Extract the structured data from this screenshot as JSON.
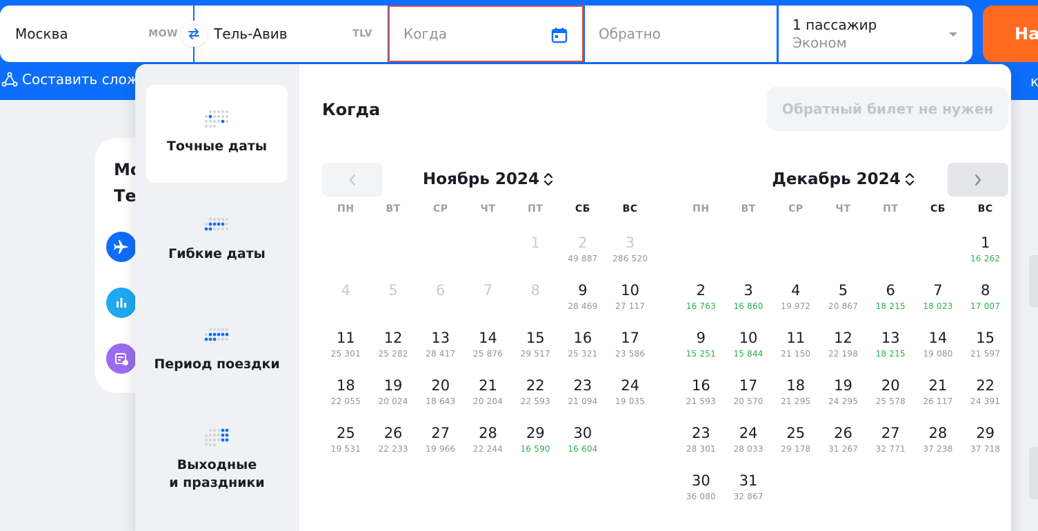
{
  "search": {
    "origin_city": "Москва",
    "origin_code": "MOW",
    "dest_city": "Тель-Авив",
    "dest_code": "TLV",
    "date_placeholder": "Когда",
    "return_placeholder": "Обратно",
    "passengers": "1 пассажир",
    "cabin": "Эконом",
    "button_label": "На"
  },
  "subbar": {
    "compose_link": "Составить слож",
    "right_fragment": "к"
  },
  "background": {
    "card_line1": "Мо",
    "card_line2": "Те"
  },
  "popup": {
    "title": "Когда",
    "no_return": "Обратный билет не нужен",
    "modes": [
      {
        "label": "Точные даты",
        "active": true
      },
      {
        "label": "Гибкие даты",
        "active": false
      },
      {
        "label": "Период поездки",
        "active": false
      },
      {
        "label": "Выходные\nи праздники",
        "active": false
      }
    ]
  },
  "weekdays": [
    "ПН",
    "ВТ",
    "СР",
    "ЧТ",
    "ПТ",
    "СБ",
    "ВС"
  ],
  "months": [
    {
      "title": "Ноябрь 2024",
      "offset": 4,
      "days": [
        {
          "d": "1",
          "price": "",
          "past": true
        },
        {
          "d": "2",
          "price": "49 887",
          "past": true
        },
        {
          "d": "3",
          "price": "286 520",
          "past": true
        },
        {
          "d": "4",
          "price": "",
          "past": true
        },
        {
          "d": "5",
          "price": "",
          "past": true
        },
        {
          "d": "6",
          "price": "",
          "past": true
        },
        {
          "d": "7",
          "price": "",
          "past": true
        },
        {
          "d": "8",
          "price": "",
          "past": true
        },
        {
          "d": "9",
          "price": "28 469"
        },
        {
          "d": "10",
          "price": "27 117"
        },
        {
          "d": "11",
          "price": "25 301"
        },
        {
          "d": "12",
          "price": "25 282"
        },
        {
          "d": "13",
          "price": "28 417"
        },
        {
          "d": "14",
          "price": "25 876"
        },
        {
          "d": "15",
          "price": "29 517"
        },
        {
          "d": "16",
          "price": "25 321"
        },
        {
          "d": "17",
          "price": "23 586"
        },
        {
          "d": "18",
          "price": "22 055"
        },
        {
          "d": "19",
          "price": "20 024"
        },
        {
          "d": "20",
          "price": "18 643"
        },
        {
          "d": "21",
          "price": "20 204"
        },
        {
          "d": "22",
          "price": "22 593"
        },
        {
          "d": "23",
          "price": "21 094"
        },
        {
          "d": "24",
          "price": "19 035"
        },
        {
          "d": "25",
          "price": "19 531"
        },
        {
          "d": "26",
          "price": "22 233"
        },
        {
          "d": "27",
          "price": "19 966"
        },
        {
          "d": "28",
          "price": "22 244"
        },
        {
          "d": "29",
          "price": "16 590",
          "cheap": true
        },
        {
          "d": "30",
          "price": "16 604",
          "cheap": true
        }
      ]
    },
    {
      "title": "Декабрь 2024",
      "offset": 6,
      "days": [
        {
          "d": "1",
          "price": "16 262",
          "cheap": true
        },
        {
          "d": "2",
          "price": "16 763",
          "cheap": true
        },
        {
          "d": "3",
          "price": "16 860",
          "cheap": true
        },
        {
          "d": "4",
          "price": "19 972"
        },
        {
          "d": "5",
          "price": "20 867"
        },
        {
          "d": "6",
          "price": "18 215",
          "cheap": true
        },
        {
          "d": "7",
          "price": "18 023",
          "cheap": true
        },
        {
          "d": "8",
          "price": "17 007",
          "cheap": true
        },
        {
          "d": "9",
          "price": "15 251",
          "cheap": true
        },
        {
          "d": "10",
          "price": "15 844",
          "cheap": true
        },
        {
          "d": "11",
          "price": "21 150"
        },
        {
          "d": "12",
          "price": "22 198"
        },
        {
          "d": "13",
          "price": "18 215",
          "cheap": true
        },
        {
          "d": "14",
          "price": "19 080"
        },
        {
          "d": "15",
          "price": "21 597"
        },
        {
          "d": "16",
          "price": "21 593"
        },
        {
          "d": "17",
          "price": "20 570"
        },
        {
          "d": "18",
          "price": "21 295"
        },
        {
          "d": "19",
          "price": "24 295"
        },
        {
          "d": "20",
          "price": "25 578"
        },
        {
          "d": "21",
          "price": "26 117"
        },
        {
          "d": "22",
          "price": "24 391"
        },
        {
          "d": "23",
          "price": "28 301"
        },
        {
          "d": "24",
          "price": "28 033"
        },
        {
          "d": "25",
          "price": "29 178"
        },
        {
          "d": "26",
          "price": "31 267"
        },
        {
          "d": "27",
          "price": "32 771"
        },
        {
          "d": "28",
          "price": "37 238"
        },
        {
          "d": "29",
          "price": "37 718"
        },
        {
          "d": "30",
          "price": "36 080"
        },
        {
          "d": "31",
          "price": "32 867"
        }
      ]
    }
  ],
  "colors": {
    "brand_blue": "#0d6efb",
    "search_orange": "#ff6a21",
    "focus_border": "#e5533c",
    "cheap_green": "#2eaf4a"
  },
  "icons": {
    "swap": "swap-arrows-icon",
    "calendar": "calendar-icon",
    "compose": "route-nodes-icon",
    "prev": "chevron-left-icon",
    "next": "chevron-right-icon",
    "sort": "chevron-updown-icon"
  }
}
